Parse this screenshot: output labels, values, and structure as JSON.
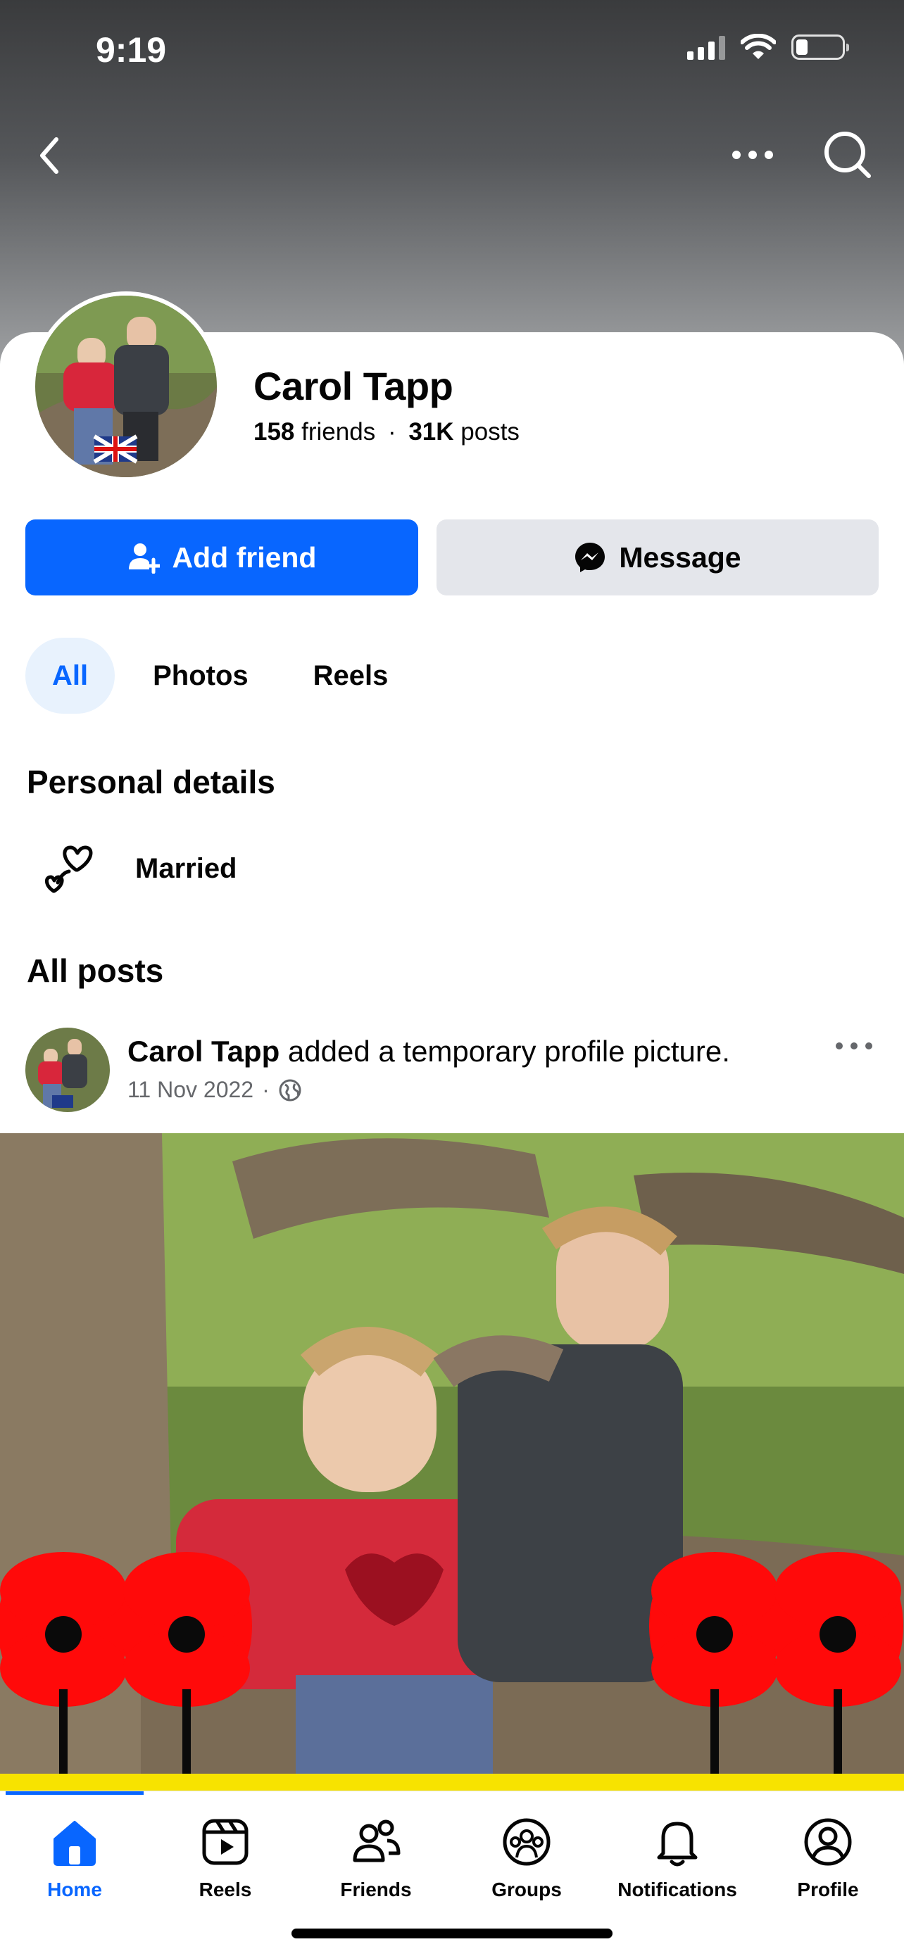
{
  "status_bar": {
    "time": "9:19"
  },
  "profile": {
    "name": "Carol Tapp",
    "friends_count": "158",
    "friends_word": "friends",
    "separator": "·",
    "posts_count": "31K",
    "posts_word": "posts"
  },
  "actions": {
    "add_friend": "Add friend",
    "message": "Message"
  },
  "tabs": [
    {
      "label": "All",
      "active": true
    },
    {
      "label": "Photos",
      "active": false
    },
    {
      "label": "Reels",
      "active": false
    }
  ],
  "personal_details": {
    "title": "Personal details",
    "relationship": "Married"
  },
  "all_posts": {
    "title": "All posts",
    "post": {
      "author": "Carol Tapp",
      "action": "added a temporary profile picture.",
      "date": "11 Nov 2022",
      "dot": "·",
      "privacy_icon": "globe-icon"
    }
  },
  "bottom_nav": [
    {
      "label": "Home",
      "icon": "home-icon",
      "active": true
    },
    {
      "label": "Reels",
      "icon": "reels-icon",
      "active": false
    },
    {
      "label": "Friends",
      "icon": "friends-icon",
      "active": false
    },
    {
      "label": "Groups",
      "icon": "groups-icon",
      "active": false
    },
    {
      "label": "Notifications",
      "icon": "bell-icon",
      "active": false
    },
    {
      "label": "Profile",
      "icon": "profile-icon",
      "active": false
    }
  ],
  "colors": {
    "accent": "#0866ff",
    "poppy": "#ff0a0a",
    "secondary_button": "#e4e6eb"
  }
}
